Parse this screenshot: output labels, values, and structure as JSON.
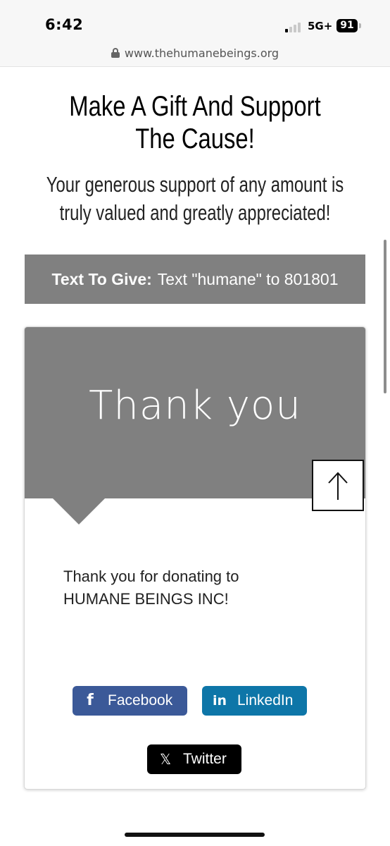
{
  "status_bar": {
    "time": "6:42",
    "network": "5G+",
    "battery": "91"
  },
  "browser": {
    "url": "www.thehumanebeings.org"
  },
  "header": {
    "title_line1": "Make A Gift And Support",
    "title_line2": "The Cause!",
    "subtitle_line1": "Your generous support of any amount is",
    "subtitle_line2": "truly valued and greatly appreciated!"
  },
  "text_to_give": {
    "label": "Text To Give:",
    "instruction": "Text \"humane\" to 801801"
  },
  "donation_card": {
    "heading": "Thank you",
    "message_line1": "Thank you for donating to",
    "message_line2": "HUMANE BEINGS INC!",
    "share_buttons": {
      "facebook": {
        "icon": "f",
        "label": "Facebook",
        "color": "#3b5998"
      },
      "linkedin": {
        "icon": "in",
        "label": "LinkedIn",
        "color": "#0e76a8"
      },
      "twitter": {
        "icon": "𝕏",
        "label": "Twitter",
        "color": "#000000"
      }
    }
  },
  "colors": {
    "banner_gray": "#808080",
    "background": "#ffffff"
  }
}
